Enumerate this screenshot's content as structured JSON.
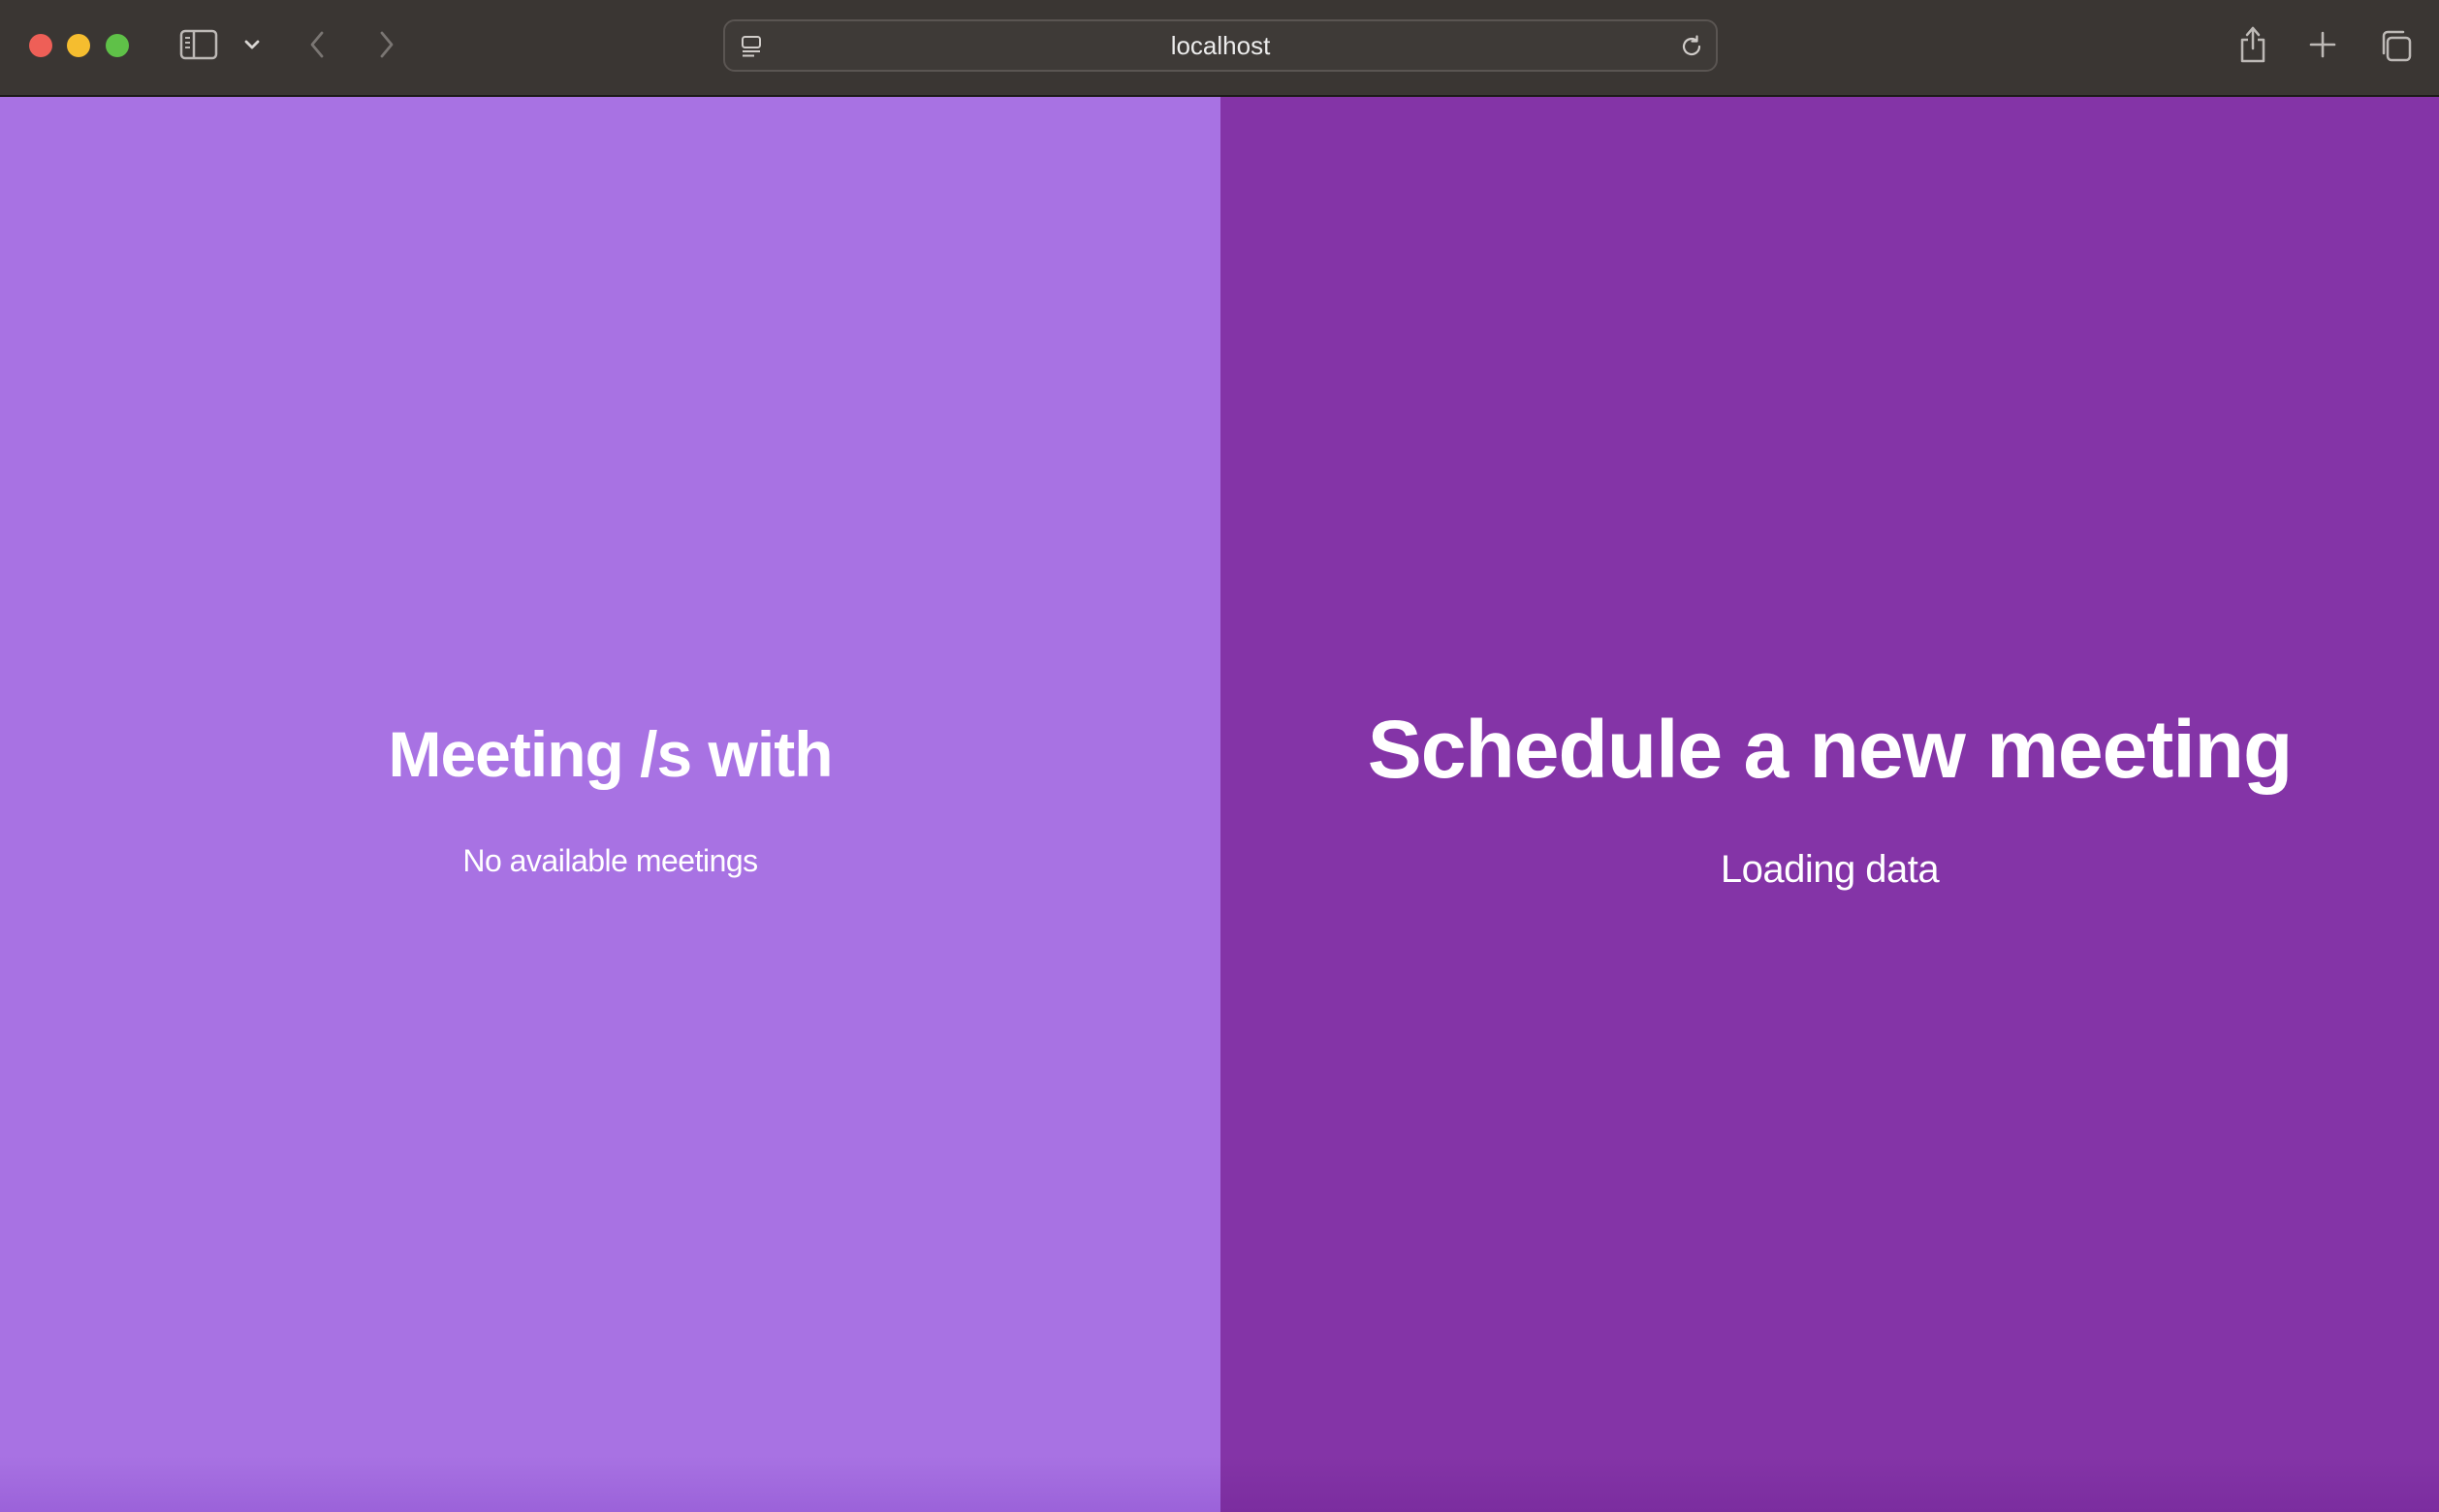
{
  "browser": {
    "url": "localhost",
    "icons": {
      "close": "close-icon",
      "minimize": "minimize-icon",
      "maximize": "maximize-icon",
      "sidebar": "sidebar-icon",
      "sidebar_menu": "chevron-down-icon",
      "back": "chevron-left-icon",
      "forward": "chevron-right-icon",
      "site": "page-settings-icon",
      "reload": "reload-icon",
      "share": "share-icon",
      "new_tab": "plus-icon",
      "tab_overview": "tab-overview-icon"
    }
  },
  "left_panel": {
    "title": "Meeting /s with",
    "message": "No available meetings",
    "background_color": "#a872e3"
  },
  "right_panel": {
    "title": "Schedule a new meeting",
    "message": "Loading data",
    "background_color": "#8434a7"
  }
}
